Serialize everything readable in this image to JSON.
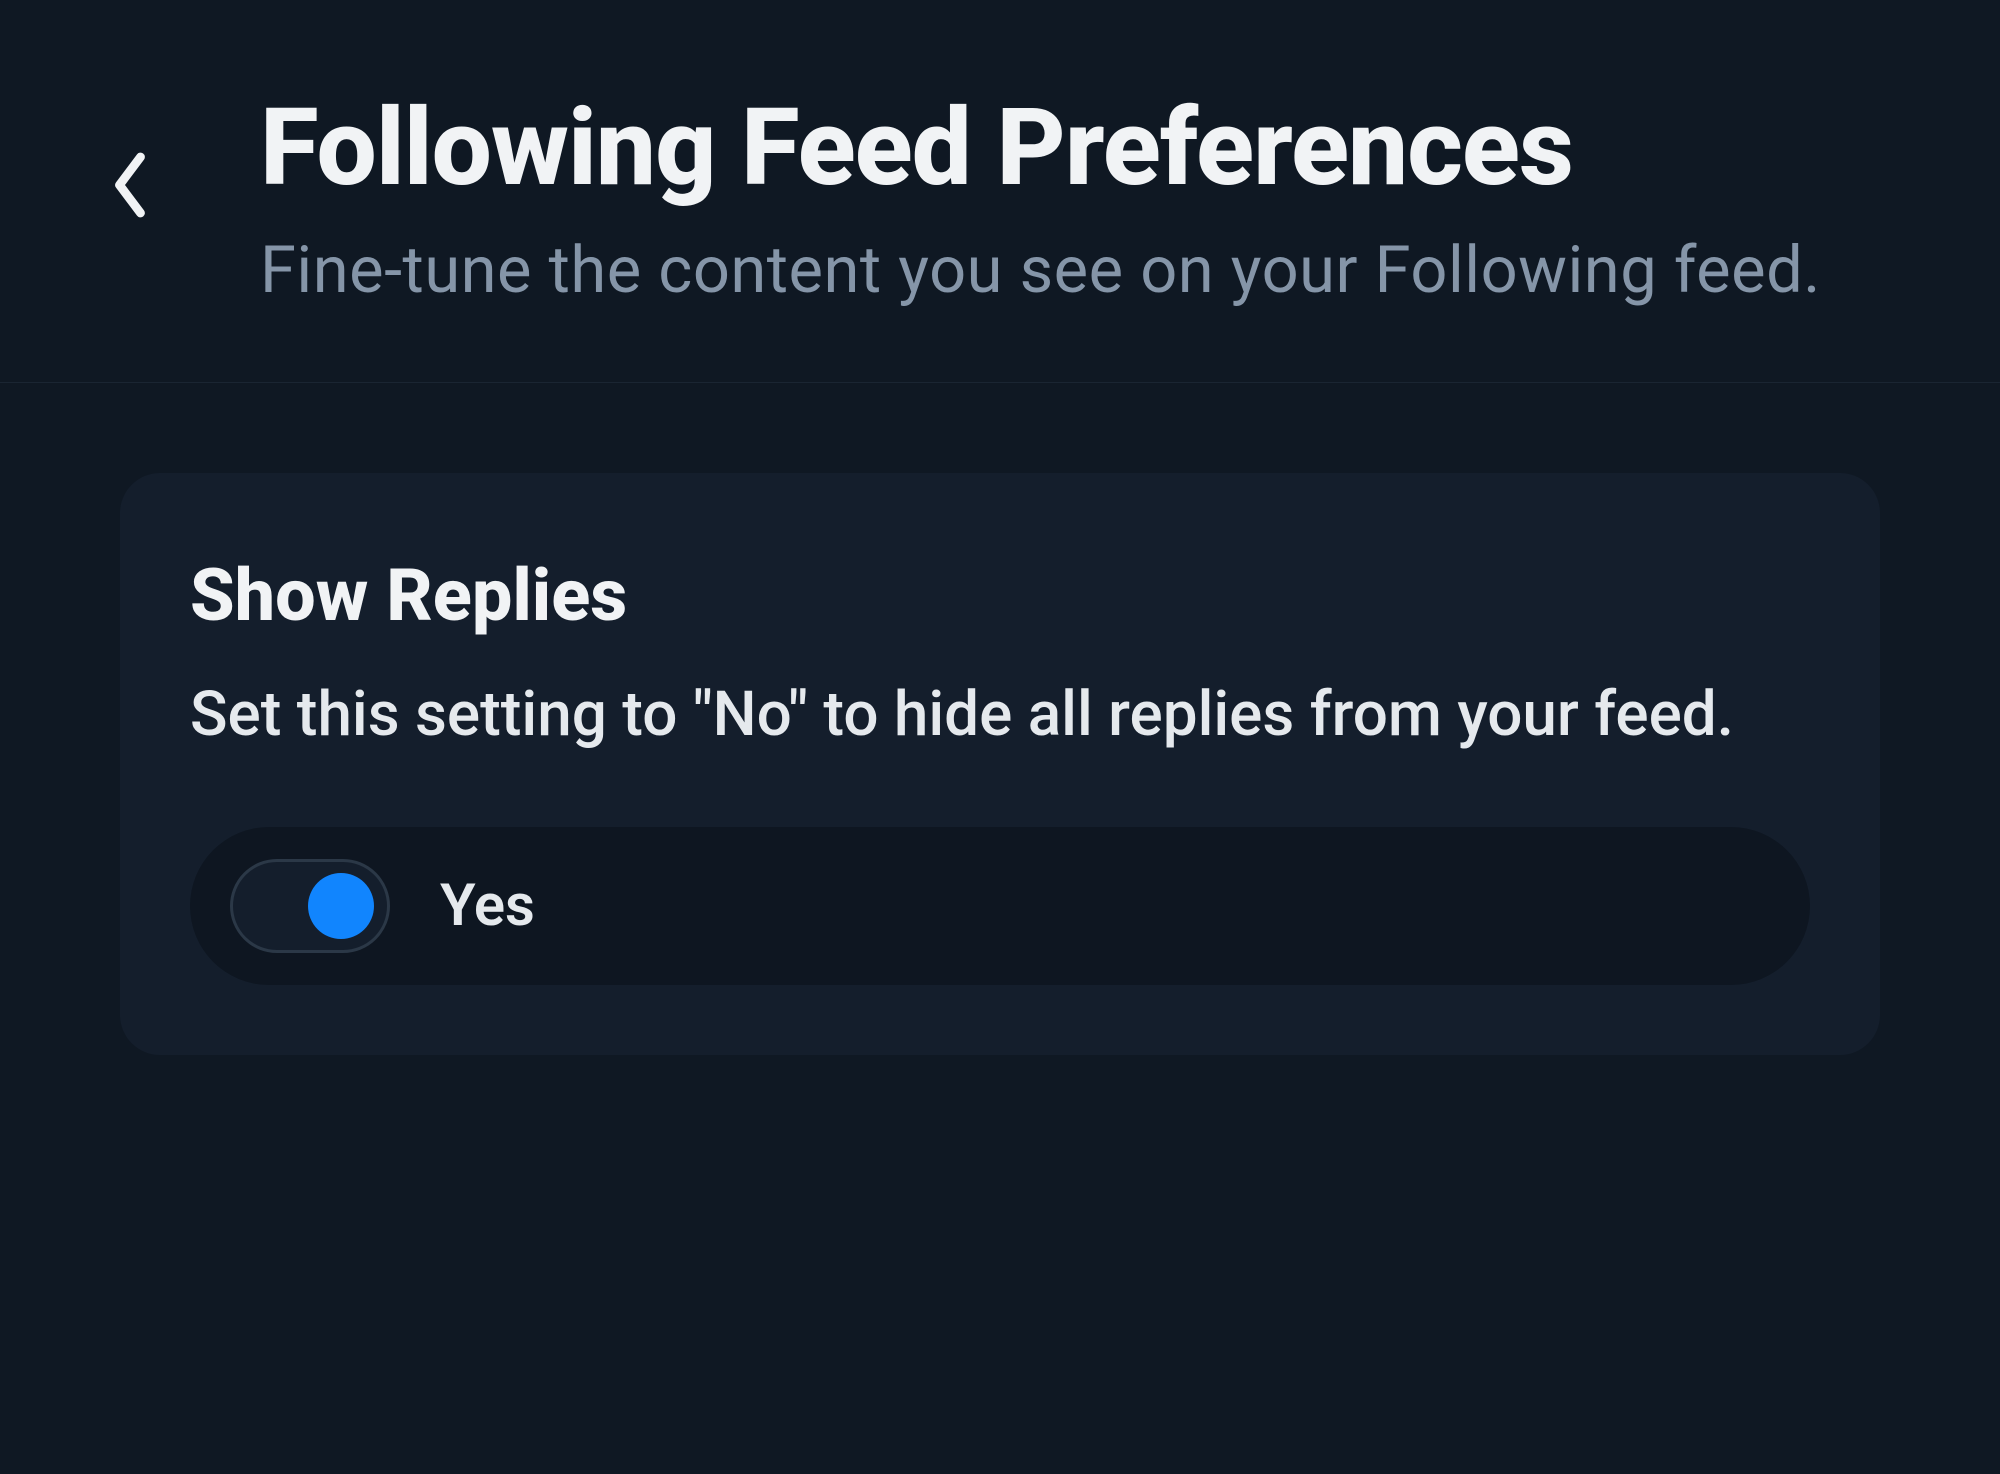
{
  "header": {
    "title": "Following Feed Preferences",
    "subtitle": "Fine-tune the content you see on your Following feed."
  },
  "settings": {
    "showReplies": {
      "title": "Show Replies",
      "description": "Set this setting to \"No\" to hide all replies from your feed.",
      "toggleLabel": "Yes",
      "toggleState": "on"
    }
  }
}
